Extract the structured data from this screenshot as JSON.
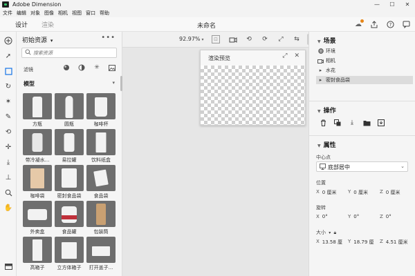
{
  "window": {
    "app_title": "Adobe Dimension",
    "minimize": "—",
    "maximize": "☐",
    "close": "✕"
  },
  "menu": [
    "文件",
    "编辑",
    "对象",
    "图像",
    "相机",
    "视图",
    "窗口",
    "帮助"
  ],
  "modes": {
    "design": "设计",
    "render": "渲染"
  },
  "document_title": "未命名",
  "assets": {
    "header": "初始资源",
    "more": "•••",
    "search_placeholder": "搜索资源",
    "filter_label": "滤镜",
    "section": "模型",
    "items": [
      {
        "label": "方瓶"
      },
      {
        "label": "圆瓶"
      },
      {
        "label": "咖啡杯"
      },
      {
        "label": "带冷凝水..."
      },
      {
        "label": "易拉罐"
      },
      {
        "label": "饮料纸盒"
      },
      {
        "label": "咖啡袋"
      },
      {
        "label": "密封食品袋"
      },
      {
        "label": "食品袋"
      },
      {
        "label": "外卖盒"
      },
      {
        "label": "食品罐"
      },
      {
        "label": "包装筒"
      },
      {
        "label": "高箱子"
      },
      {
        "label": "立方体箱子"
      },
      {
        "label": "打开盖子..."
      }
    ]
  },
  "canvas": {
    "zoom": "92.97%"
  },
  "render_preview": {
    "title": "渲染预览"
  },
  "scene": {
    "title": "场景",
    "items": [
      {
        "label": "环境",
        "icon": "environment-icon"
      },
      {
        "label": "相机",
        "icon": "camera-icon"
      },
      {
        "label": "水花",
        "icon": "model-icon"
      },
      {
        "label": "密封食品袋",
        "icon": "model-icon"
      }
    ]
  },
  "actions": {
    "title": "操作"
  },
  "properties": {
    "title": "属性",
    "pivot_label": "中心点",
    "pivot_value": "底部居中",
    "position_label": "位置",
    "position": {
      "x": "0 厘米",
      "y": "0 厘米",
      "z": "0 厘米"
    },
    "rotation_label": "旋转",
    "rotation": {
      "x": "0°",
      "y": "0°",
      "z": "0°"
    },
    "size_label": "大小",
    "size": {
      "x": "13.58 厘",
      "y": "18.79 厘",
      "z": "4.51 厘米"
    }
  },
  "colors": {
    "accent": "#1473e6",
    "thumb_bg": "#6e6e6e",
    "cloud_badge": "#e68619"
  }
}
